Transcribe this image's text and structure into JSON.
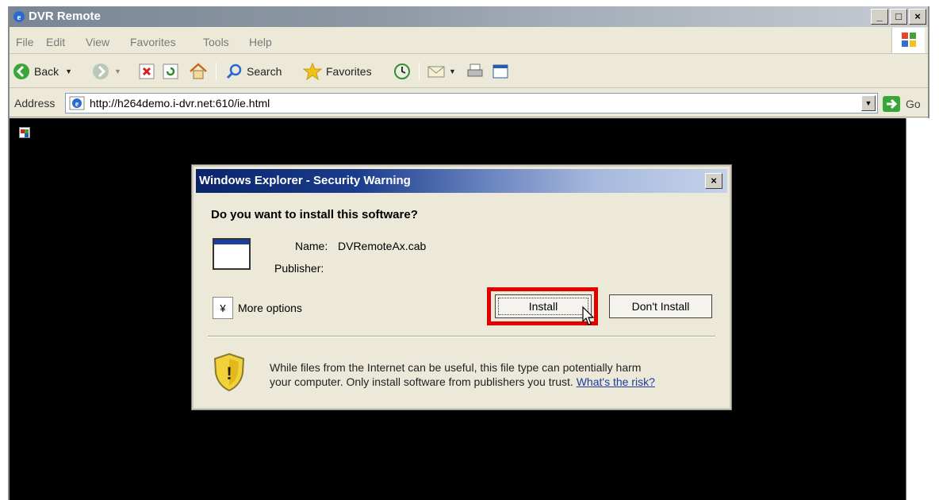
{
  "window": {
    "title": "DVR Remote",
    "controls": [
      "_",
      "□",
      "×"
    ]
  },
  "menu": {
    "items": [
      "File",
      "Edit",
      "View",
      "Favorites",
      "Tools",
      "Help"
    ]
  },
  "toolbar": {
    "back_label": "Back",
    "search_label": "Search",
    "favorites_label": "Favorites"
  },
  "address": {
    "label": "Address",
    "url": "http://h264demo.i-dvr.net:610/ie.html",
    "go_label": "Go"
  },
  "dialog": {
    "title": "Windows Explorer - Security Warning",
    "question": "Do you want to install this software?",
    "name_label": "Name:",
    "name_value": "DVRemoteAx.cab",
    "publisher_label": "Publisher:",
    "publisher_value": "",
    "more_options_label": "More options",
    "install_label": "Install",
    "dont_install_label": "Don't Install",
    "warning_line1": "While files from the Internet can be useful, this file type can potentially harm",
    "warning_line2": "your computer. Only install software from publishers you trust.",
    "risk_link": "What's the risk?"
  },
  "colors": {
    "highlight": "#e00000",
    "title_bar": "#0a246a",
    "link": "#1a3c9c"
  }
}
